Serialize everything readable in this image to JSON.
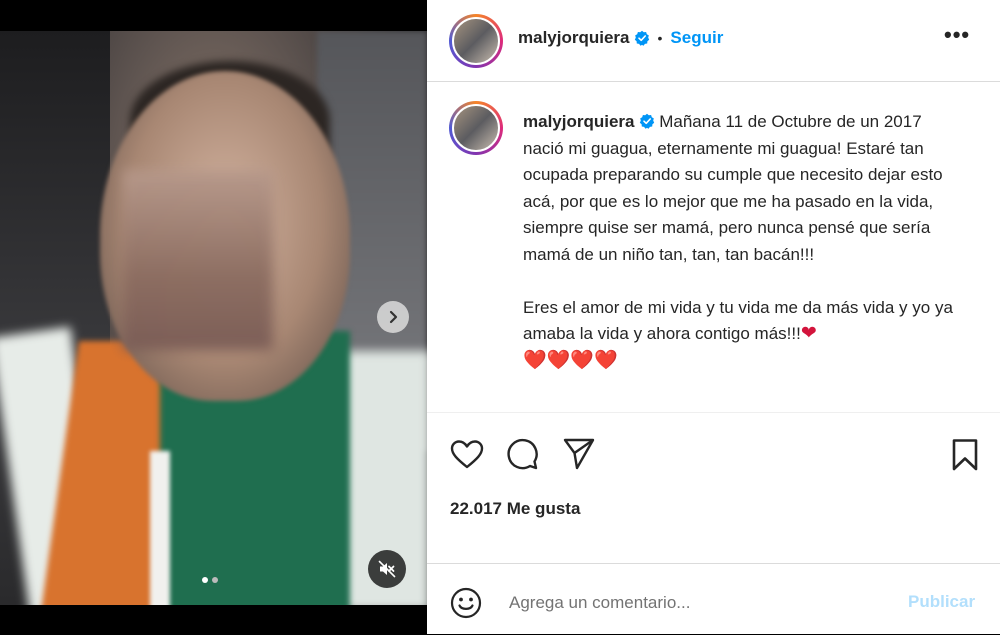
{
  "post": {
    "username": "malyjorquiera",
    "separator": "•",
    "follow_label": "Seguir",
    "more_label": "•••",
    "caption_line1": "Mañana 11 de Octubre de un 2017 nació mi guagua, eternamente mi guagua! Estaré tan ocupada preparando su cumple que necesito dejar esto acá, por que es lo mejor que me ha pasado en la vida, siempre quise ser mamá, pero nunca pensé que sería mamá de un niño tan, tan, tan bacán!!!",
    "caption_line2": "Eres el amor de mi vida y tu vida me da más vida y yo ya amaba la vida y ahora contigo más!!!",
    "heart_emoji": "❤",
    "hearts_row": "❤️❤️❤️❤️",
    "likes": "22.017 Me gusta"
  },
  "media": {
    "next_icon": "chevron-right-icon",
    "mute_icon": "muted-speaker-icon",
    "carousel_count": 2,
    "carousel_active": 0
  },
  "comment": {
    "placeholder": "Agrega un comentario...",
    "publish_label": "Publicar"
  },
  "colors": {
    "accent": "#0095f6",
    "publish_disabled": "#b2dffc",
    "heart": "#d3143c"
  }
}
